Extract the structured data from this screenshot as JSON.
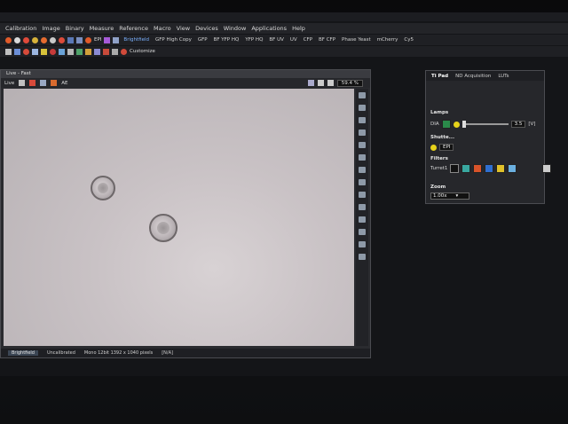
{
  "window_title": "Live - Fast",
  "menu": [
    "Calibration",
    "Image",
    "Binary",
    "Measure",
    "Reference",
    "Macro",
    "View",
    "Devices",
    "Window",
    "Applications",
    "Help"
  ],
  "toolbar1": {
    "channel_label": "EPI",
    "presets": [
      "Brightfield",
      "GFP High Copy",
      "GFP",
      "BF YFP HQ",
      "YFP HQ",
      "BF UV",
      "UV",
      "CFP",
      "BF CFP",
      "Phase Yeast",
      "mCherry",
      "Cy5"
    ]
  },
  "toolbar2": {
    "customize_label": "Customize"
  },
  "live": {
    "toolbar_left": [
      "Live",
      "AE"
    ],
    "zoom_value": "59.4 %",
    "status": {
      "tab": "Brightfield",
      "calibration": "Uncalibrated",
      "info": "Mono 12bit  1392 x 1040 pixels",
      "coord": "[N/A]"
    }
  },
  "tipad": {
    "tabs": [
      "Ti Pad",
      "ND Acquisition",
      "LUTs"
    ],
    "lamps_title": "Lamps",
    "lamp_name": "DIA",
    "lamp_value": "3.5",
    "lamp_unit": "[V]",
    "shutter_title": "Shutte...",
    "shutter_label": "EPI",
    "filters_title": "Filters",
    "turret_label": "Turret1",
    "zoom_title": "Zoom",
    "zoom_value": "1.00x"
  },
  "colors": {
    "accent": "#7ab1ff",
    "lamp_on": "#e6d21a",
    "lamp_green": "#3fbf5a"
  }
}
